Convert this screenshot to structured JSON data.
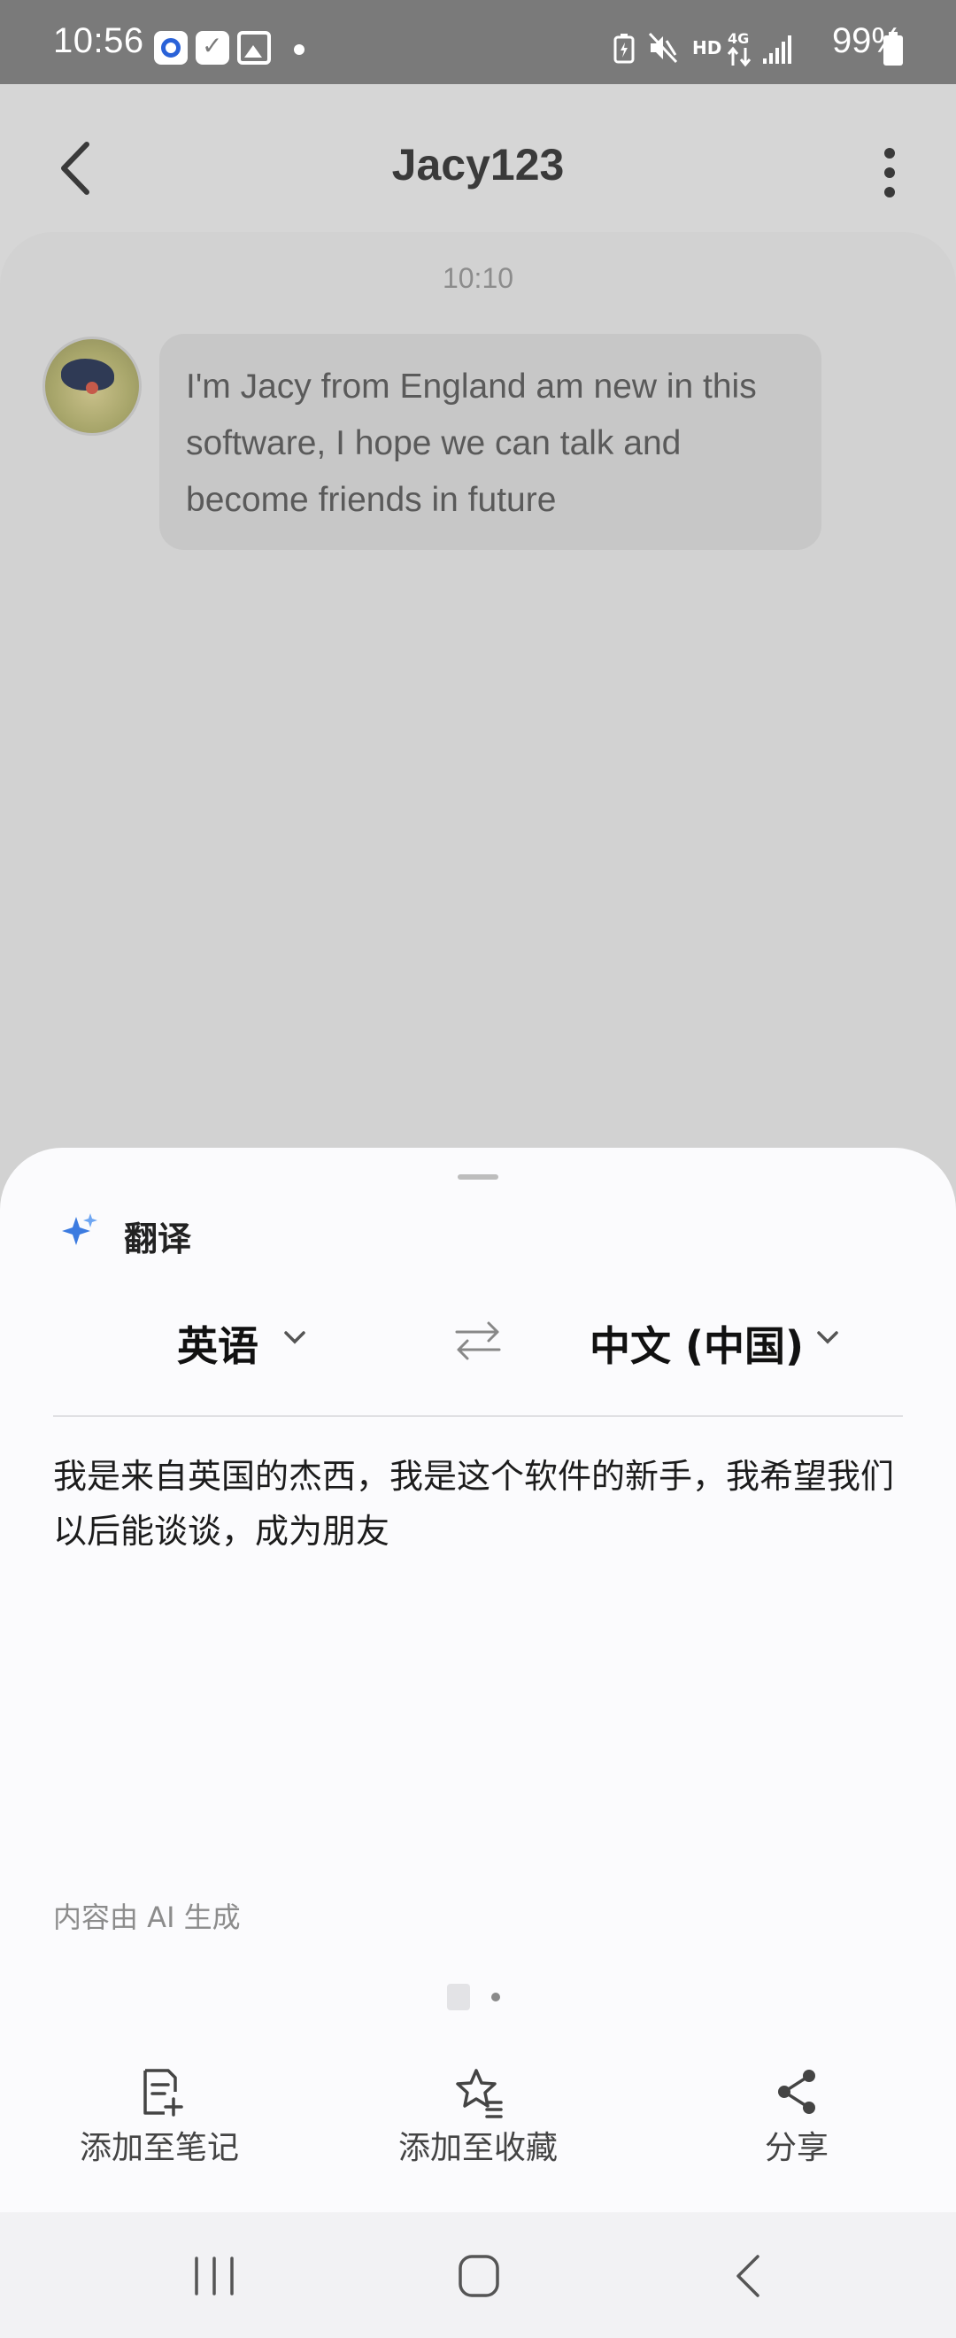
{
  "status_bar": {
    "time": "10:56",
    "battery": "99%",
    "network_label": "4G",
    "hd_label": "HD"
  },
  "header": {
    "title": "Jacy123"
  },
  "chat": {
    "timestamp": "10:10",
    "message": "I'm Jacy from England am new in this software, I hope we can talk and become friends in future"
  },
  "translate_sheet": {
    "title": "翻译",
    "source_language": "英语",
    "target_language": "中文 (中国)",
    "translation": "我是来自英国的杰西，我是这个软件的新手，我希望我们以后能谈谈，成为朋友",
    "ai_note": "内容由 AI 生成",
    "actions": [
      {
        "label": "添加至笔记",
        "icon": "note-add-icon"
      },
      {
        "label": "添加至收藏",
        "icon": "star-list-icon"
      },
      {
        "label": "分享",
        "icon": "share-icon"
      }
    ]
  },
  "colors": {
    "status_bar_bg": "#7a7a7a",
    "overlay_bg": "#d6d6d6",
    "bubble_bg": "#c7c7c7",
    "sheet_bg": "#fbfbfd"
  }
}
